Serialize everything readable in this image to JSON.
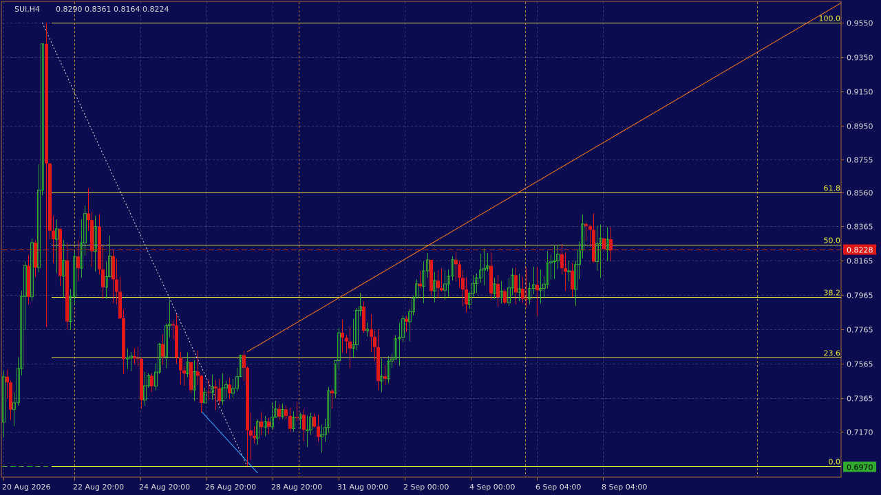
{
  "header": {
    "symbol": "SUI,H4",
    "ohlc": "0.8290 0.8361 0.8164 0.8224"
  },
  "colors": {
    "background": "#0b0b50",
    "grid": "#3a3a70",
    "frame": "#b06a3a",
    "axis_text": "#d8d8d8",
    "bull": "#2faa2f",
    "bear": "#e01818",
    "fib": "#e8e83a",
    "trendline": "#ff7a1a",
    "diagonal": "#e0e0e0",
    "blue_line": "#33aaff",
    "session_sep": "#c88a3a",
    "price_line": "#c83a1a",
    "price_tag": "#e01818",
    "low_tag": "#2faa2f"
  },
  "chart_data": {
    "type": "candlestick",
    "title": "SUI,H4",
    "ohlc_header": "0.8290 0.8361 0.8164 0.8224",
    "y_ticks": [
      "0.9550",
      "0.9350",
      "0.9150",
      "0.8950",
      "0.8755",
      "0.8560",
      "0.8365",
      "0.8165",
      "0.7965",
      "0.7765",
      "0.7565",
      "0.7365",
      "0.7170"
    ],
    "x_ticks": [
      "20 Aug 2026",
      "22 Aug 20:00",
      "24 Aug 20:00",
      "26 Aug 20:00",
      "28 Aug 20:00",
      "31 Aug 00:00",
      "2 Sep 00:00",
      "4 Sep 00:00",
      "6 Sep 04:00",
      "8 Sep 04:00"
    ],
    "ylim": [
      0.697,
      0.955
    ],
    "grid": true,
    "fibonacci": {
      "high": 0.955,
      "low": 0.697,
      "levels": [
        {
          "label": "100.0",
          "price": 0.955
        },
        {
          "label": "61.8",
          "price": 0.856
        },
        {
          "label": "50.0",
          "price": 0.826
        },
        {
          "label": "38.2",
          "price": 0.7955
        },
        {
          "label": "23.6",
          "price": 0.76
        },
        {
          "label": "0.0",
          "price": 0.697
        }
      ]
    },
    "trendline": {
      "from": {
        "candle": 69,
        "price": 0.7635
      },
      "to": {
        "candle": 178,
        "price": 0.895
      }
    },
    "diagonal": {
      "from": {
        "candle": 11,
        "price": 0.955
      },
      "to": {
        "candle": 69,
        "price": 0.697
      }
    },
    "blue_line": {
      "from": {
        "candle": 56,
        "price": 0.729
      },
      "to": {
        "candle": 72,
        "price": 0.693
      }
    },
    "current_price": {
      "label": "0.8228",
      "price": 0.8228
    },
    "low_price": {
      "label": "0.6970",
      "price": 0.697
    },
    "candles": [
      [
        0.7226,
        0.7525,
        0.7136,
        0.749
      ],
      [
        0.749,
        0.7529,
        0.7364,
        0.7457
      ],
      [
        0.7457,
        0.7467,
        0.7237,
        0.7299
      ],
      [
        0.7299,
        0.74,
        0.7203,
        0.7339
      ],
      [
        0.7339,
        0.7604,
        0.7322,
        0.7538
      ],
      [
        0.7538,
        0.7992,
        0.7497,
        0.7957
      ],
      [
        0.7957,
        0.816,
        0.7761,
        0.8136
      ],
      [
        0.8136,
        0.82,
        0.7911,
        0.7955
      ],
      [
        0.7955,
        0.8295,
        0.793,
        0.827
      ],
      [
        0.827,
        0.8283,
        0.8071,
        0.8125
      ],
      [
        0.8125,
        0.8726,
        0.8097,
        0.8576
      ],
      [
        0.8576,
        0.9427,
        0.8546,
        0.9427
      ],
      [
        0.9427,
        0.955,
        0.7779,
        0.8731
      ],
      [
        0.8731,
        0.8408,
        0.829,
        0.834
      ],
      [
        0.834,
        0.8425,
        0.8151,
        0.829
      ],
      [
        0.829,
        0.8405,
        0.8092,
        0.8351
      ],
      [
        0.8351,
        0.8249,
        0.8017,
        0.8076
      ],
      [
        0.8076,
        0.8286,
        0.7951,
        0.8167
      ],
      [
        0.8167,
        0.8267,
        0.7765,
        0.7812
      ],
      [
        0.7812,
        0.8,
        0.7761,
        0.7958
      ],
      [
        0.7958,
        0.822,
        0.7911,
        0.819
      ],
      [
        0.819,
        0.8283,
        0.8047,
        0.8122
      ],
      [
        0.8122,
        0.8407,
        0.8066,
        0.8269
      ],
      [
        0.8269,
        0.8486,
        0.8195,
        0.844
      ],
      [
        0.844,
        0.8587,
        0.834,
        0.8401
      ],
      [
        0.8401,
        0.8448,
        0.813,
        0.822
      ],
      [
        0.822,
        0.8428,
        0.8103,
        0.8364
      ],
      [
        0.8364,
        0.8436,
        0.8087,
        0.8115
      ],
      [
        0.8115,
        0.8256,
        0.7944,
        0.8011
      ],
      [
        0.8011,
        0.816,
        0.7943,
        0.8072
      ],
      [
        0.8072,
        0.8312,
        0.8067,
        0.8192
      ],
      [
        0.8192,
        0.8232,
        0.7917,
        0.8056
      ],
      [
        0.8056,
        0.8177,
        0.7912,
        0.7984
      ],
      [
        0.7984,
        0.807,
        0.7826,
        0.783
      ],
      [
        0.783,
        0.7881,
        0.7507,
        0.7593
      ],
      [
        0.7593,
        0.7656,
        0.7534,
        0.7599
      ],
      [
        0.7599,
        0.7634,
        0.7522,
        0.761
      ],
      [
        0.761,
        0.7657,
        0.756,
        0.7597
      ],
      [
        0.7597,
        0.7665,
        0.755,
        0.7594
      ],
      [
        0.7594,
        0.7603,
        0.7304,
        0.7354
      ],
      [
        0.7354,
        0.7519,
        0.732,
        0.7438
      ],
      [
        0.7438,
        0.751,
        0.7426,
        0.7496
      ],
      [
        0.7496,
        0.7512,
        0.7401,
        0.7435
      ],
      [
        0.7435,
        0.7568,
        0.741,
        0.7517
      ],
      [
        0.7517,
        0.7687,
        0.7508,
        0.768
      ],
      [
        0.768,
        0.7737,
        0.756,
        0.7606
      ],
      [
        0.7606,
        0.7799,
        0.754,
        0.7787
      ],
      [
        0.7787,
        0.7936,
        0.772,
        0.7796
      ],
      [
        0.7796,
        0.7816,
        0.7707,
        0.7788
      ],
      [
        0.7788,
        0.7852,
        0.7566,
        0.7601
      ],
      [
        0.7601,
        0.7636,
        0.7445,
        0.7527
      ],
      [
        0.7527,
        0.7554,
        0.7437,
        0.7509
      ],
      [
        0.7509,
        0.7632,
        0.7487,
        0.7575
      ],
      [
        0.7575,
        0.757,
        0.7392,
        0.7413
      ],
      [
        0.7413,
        0.7586,
        0.7351,
        0.752
      ],
      [
        0.752,
        0.7642,
        0.7443,
        0.7496
      ],
      [
        0.7496,
        0.7499,
        0.7281,
        0.7338
      ],
      [
        0.7338,
        0.7426,
        0.7341,
        0.74
      ],
      [
        0.74,
        0.7475,
        0.7353,
        0.7399
      ],
      [
        0.7399,
        0.7502,
        0.7355,
        0.7433
      ],
      [
        0.7433,
        0.7467,
        0.7298,
        0.7422
      ],
      [
        0.7422,
        0.7479,
        0.7328,
        0.735
      ],
      [
        0.735,
        0.7511,
        0.7326,
        0.7425
      ],
      [
        0.7425,
        0.7468,
        0.7366,
        0.7445
      ],
      [
        0.7445,
        0.7485,
        0.7359,
        0.7394
      ],
      [
        0.7394,
        0.7478,
        0.7368,
        0.7422
      ],
      [
        0.7422,
        0.7542,
        0.7403,
        0.7491
      ],
      [
        0.7491,
        0.7616,
        0.7492,
        0.7616
      ],
      [
        0.7616,
        0.764,
        0.7463,
        0.7542
      ],
      [
        0.7542,
        0.7549,
        0.697,
        0.7178
      ],
      [
        0.7178,
        0.7283,
        0.7006,
        0.7147
      ],
      [
        0.7147,
        0.7202,
        0.7102,
        0.7133
      ],
      [
        0.7133,
        0.7241,
        0.7094,
        0.7229
      ],
      [
        0.7229,
        0.7284,
        0.7151,
        0.7197
      ],
      [
        0.7197,
        0.7262,
        0.7144,
        0.7229
      ],
      [
        0.7229,
        0.7252,
        0.7157,
        0.7199
      ],
      [
        0.7199,
        0.734,
        0.7181,
        0.7254
      ],
      [
        0.7254,
        0.7351,
        0.7252,
        0.7303
      ],
      [
        0.7303,
        0.7332,
        0.7238,
        0.7258
      ],
      [
        0.7258,
        0.7335,
        0.7244,
        0.73
      ],
      [
        0.73,
        0.7324,
        0.7243,
        0.7262
      ],
      [
        0.7262,
        0.731,
        0.7168,
        0.7188
      ],
      [
        0.7188,
        0.7289,
        0.717,
        0.7254
      ],
      [
        0.7254,
        0.7346,
        0.7229,
        0.7249
      ],
      [
        0.7249,
        0.728,
        0.7187,
        0.7269
      ],
      [
        0.7269,
        0.7301,
        0.7115,
        0.7181
      ],
      [
        0.7181,
        0.7265,
        0.7081,
        0.7181
      ],
      [
        0.7181,
        0.7281,
        0.7151,
        0.7257
      ],
      [
        0.7257,
        0.7275,
        0.7194,
        0.72
      ],
      [
        0.72,
        0.727,
        0.7112,
        0.714
      ],
      [
        0.714,
        0.7212,
        0.7048,
        0.7154
      ],
      [
        0.7154,
        0.7246,
        0.7111,
        0.7195
      ],
      [
        0.7195,
        0.7431,
        0.7164,
        0.7408
      ],
      [
        0.7408,
        0.7418,
        0.7306,
        0.7394
      ],
      [
        0.7394,
        0.7567,
        0.7364,
        0.7584
      ],
      [
        0.7584,
        0.7772,
        0.7535,
        0.7746
      ],
      [
        0.7746,
        0.7821,
        0.763,
        0.7717
      ],
      [
        0.7717,
        0.7733,
        0.7626,
        0.7695
      ],
      [
        0.7695,
        0.7783,
        0.7538,
        0.7655
      ],
      [
        0.7655,
        0.7828,
        0.7606,
        0.7676
      ],
      [
        0.7676,
        0.7891,
        0.7645,
        0.7876
      ],
      [
        0.7876,
        0.7978,
        0.7843,
        0.7898
      ],
      [
        0.7898,
        0.7929,
        0.7745,
        0.7758
      ],
      [
        0.7758,
        0.7806,
        0.7724,
        0.7767
      ],
      [
        0.7767,
        0.7854,
        0.7633,
        0.7722
      ],
      [
        0.7722,
        0.7758,
        0.7582,
        0.7663
      ],
      [
        0.7663,
        0.7767,
        0.7412,
        0.7465
      ],
      [
        0.7465,
        0.7597,
        0.7401,
        0.7493
      ],
      [
        0.7493,
        0.7557,
        0.7442,
        0.7478
      ],
      [
        0.7478,
        0.761,
        0.7452,
        0.7581
      ],
      [
        0.7581,
        0.7624,
        0.7543,
        0.7593
      ],
      [
        0.7593,
        0.7732,
        0.7594,
        0.7711
      ],
      [
        0.7711,
        0.7804,
        0.7552,
        0.772
      ],
      [
        0.772,
        0.7848,
        0.7689,
        0.7828
      ],
      [
        0.7828,
        0.7844,
        0.7751,
        0.781
      ],
      [
        0.781,
        0.7883,
        0.7696,
        0.7868
      ],
      [
        0.7868,
        0.7962,
        0.7847,
        0.7949
      ],
      [
        0.7949,
        0.8057,
        0.7957,
        0.8031
      ],
      [
        0.8031,
        0.8106,
        0.8006,
        0.8017
      ],
      [
        0.8017,
        0.8161,
        0.7917,
        0.8106
      ],
      [
        0.8106,
        0.821,
        0.8066,
        0.817
      ],
      [
        0.817,
        0.814,
        0.7961,
        0.7989
      ],
      [
        0.7989,
        0.81,
        0.7922,
        0.8049
      ],
      [
        0.8049,
        0.811,
        0.7945,
        0.8006
      ],
      [
        0.8006,
        0.8122,
        0.7985,
        0.7993
      ],
      [
        0.7993,
        0.8109,
        0.7936,
        0.803
      ],
      [
        0.803,
        0.8115,
        0.7957,
        0.8076
      ],
      [
        0.8076,
        0.8191,
        0.805,
        0.8171
      ],
      [
        0.8171,
        0.8213,
        0.8044,
        0.8144
      ],
      [
        0.8144,
        0.8166,
        0.8007,
        0.8065
      ],
      [
        0.8065,
        0.8111,
        0.79,
        0.7998
      ],
      [
        0.7998,
        0.807,
        0.7866,
        0.7911
      ],
      [
        0.7911,
        0.7986,
        0.7885,
        0.7976
      ],
      [
        0.7976,
        0.8081,
        0.7955,
        0.8033
      ],
      [
        0.8033,
        0.8091,
        0.7977,
        0.8065
      ],
      [
        0.8065,
        0.8206,
        0.8037,
        0.8111
      ],
      [
        0.8111,
        0.8236,
        0.8021,
        0.8121
      ],
      [
        0.8121,
        0.8209,
        0.8103,
        0.8135
      ],
      [
        0.8135,
        0.8213,
        0.7939,
        0.7975
      ],
      [
        0.7975,
        0.8067,
        0.7945,
        0.803
      ],
      [
        0.803,
        0.8082,
        0.7898,
        0.7952
      ],
      [
        0.7952,
        0.8048,
        0.7917,
        0.7988
      ],
      [
        0.7988,
        0.8001,
        0.7913,
        0.7921
      ],
      [
        0.7921,
        0.8065,
        0.7903,
        0.8007
      ],
      [
        0.8007,
        0.8121,
        0.7964,
        0.8081
      ],
      [
        0.8081,
        0.8126,
        0.7913,
        0.7981
      ],
      [
        0.7981,
        0.8089,
        0.793,
        0.8002
      ],
      [
        0.8002,
        0.8069,
        0.792,
        0.7944
      ],
      [
        0.7944,
        0.8126,
        0.7896,
        0.7942
      ],
      [
        0.7942,
        0.8037,
        0.7912,
        0.8004
      ],
      [
        0.8004,
        0.8131,
        0.797,
        0.8025
      ],
      [
        0.8025,
        0.8128,
        0.7846,
        0.7993
      ],
      [
        0.7993,
        0.8114,
        0.7916,
        0.8004
      ],
      [
        0.8004,
        0.8074,
        0.7949,
        0.8029
      ],
      [
        0.8029,
        0.8221,
        0.8004,
        0.8152
      ],
      [
        0.8152,
        0.82,
        0.8056,
        0.8159
      ],
      [
        0.8159,
        0.8259,
        0.8059,
        0.8164
      ],
      [
        0.8164,
        0.8259,
        0.8116,
        0.8203
      ],
      [
        0.8203,
        0.8263,
        0.8086,
        0.8122
      ],
      [
        0.8122,
        0.8215,
        0.799,
        0.8101
      ],
      [
        0.8101,
        0.8164,
        0.8045,
        0.8106
      ],
      [
        0.8106,
        0.8152,
        0.7955,
        0.7998
      ],
      [
        0.7998,
        0.8164,
        0.7902,
        0.8143
      ],
      [
        0.8143,
        0.8277,
        0.8058,
        0.8227
      ],
      [
        0.8227,
        0.8435,
        0.8178,
        0.8379
      ],
      [
        0.8379,
        0.8384,
        0.8282,
        0.8367
      ],
      [
        0.8367,
        0.8376,
        0.8247,
        0.8345
      ],
      [
        0.8345,
        0.8441,
        0.8155,
        0.816
      ],
      [
        0.816,
        0.8369,
        0.8106,
        0.8264
      ],
      [
        0.8264,
        0.8377,
        0.8065,
        0.8295
      ],
      [
        0.8295,
        0.8294,
        0.8224,
        0.8233
      ],
      [
        0.8233,
        0.8361,
        0.8164,
        0.829
      ],
      [
        0.829,
        0.8361,
        0.8164,
        0.8224
      ]
    ]
  }
}
